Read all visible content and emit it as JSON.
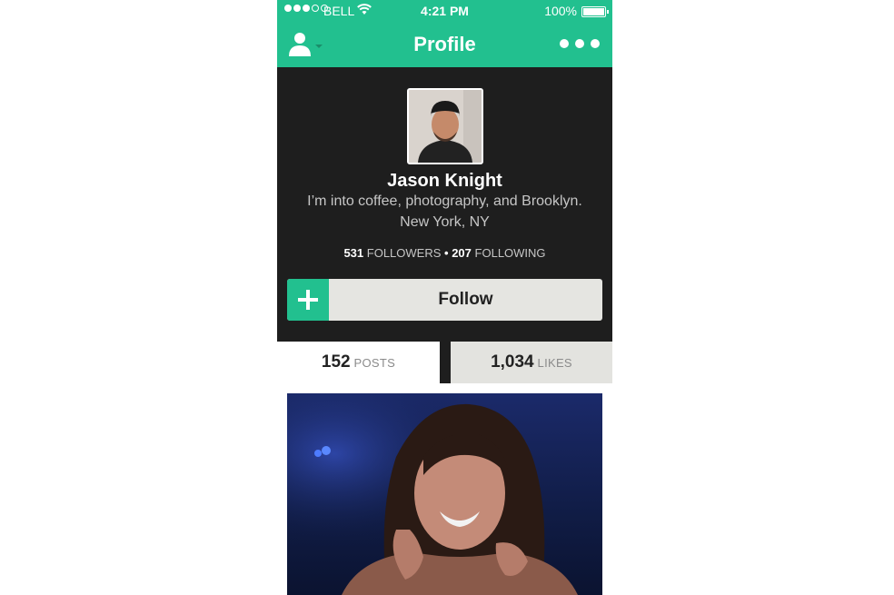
{
  "status_bar": {
    "carrier": "BELL",
    "time": "4:21 PM",
    "battery": "100%"
  },
  "nav": {
    "title": "Profile",
    "user_menu_icon": "user-dropdown-icon",
    "more_icon": "more-dots-icon"
  },
  "profile": {
    "name": "Jason Knight",
    "bio": "I’m into coffee, photography, and Brooklyn.",
    "location": "New York, NY",
    "followers_count": "531",
    "followers_label": "FOLLOWERS",
    "separator": "•",
    "following_count": "207",
    "following_label": "FOLLOWING"
  },
  "follow_button": {
    "label": "Follow"
  },
  "tabs": [
    {
      "count": "152",
      "label": "POSTS",
      "active": true
    },
    {
      "count": "1,034",
      "label": "LIKES",
      "active": false
    }
  ],
  "colors": {
    "accent": "#22c08f",
    "profile_bg": "#1e1e1e",
    "button_bg": "#e5e5e1"
  }
}
